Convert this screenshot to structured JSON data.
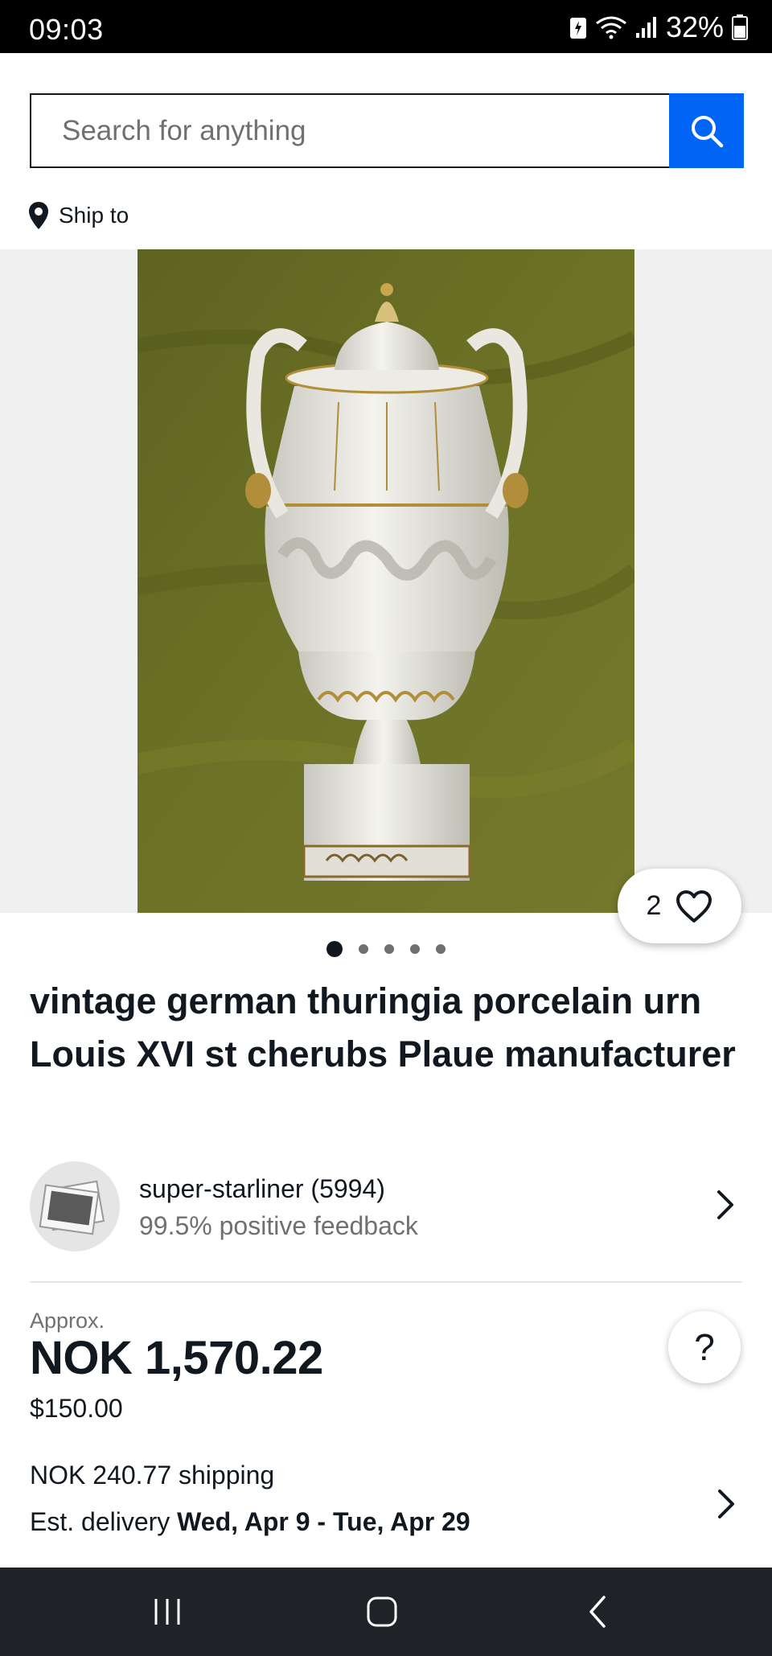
{
  "status_bar": {
    "time": "09:03",
    "battery": "32%"
  },
  "search": {
    "placeholder": "Search for anything"
  },
  "ship_to": {
    "label": "Ship to"
  },
  "gallery": {
    "image_count": 5,
    "active_index": 0,
    "watch_count": "2"
  },
  "listing": {
    "title": "vintage german thuringia porcelain urn Louis XVI st cherubs Plaue manufacturer"
  },
  "seller": {
    "name": "super-starliner (5994)",
    "feedback": "99.5% positive feedback"
  },
  "price": {
    "approx_label": "Approx.",
    "amount": "NOK 1,570.22",
    "original": "$150.00"
  },
  "shipping": {
    "cost": "NOK 240.77 shipping",
    "delivery_prefix": "Est. delivery ",
    "delivery_range": "Wed, Apr 9 - Tue, Apr 29"
  },
  "help": {
    "label": "?"
  },
  "colors": {
    "accent": "#0064f5",
    "text": "#111820",
    "muted": "#707070"
  },
  "icons": [
    "search-icon",
    "location-pin-icon",
    "heart-icon",
    "chevron-right-icon",
    "recents-icon",
    "home-icon",
    "back-icon",
    "wifi-icon",
    "signal-icon",
    "battery-icon"
  ]
}
